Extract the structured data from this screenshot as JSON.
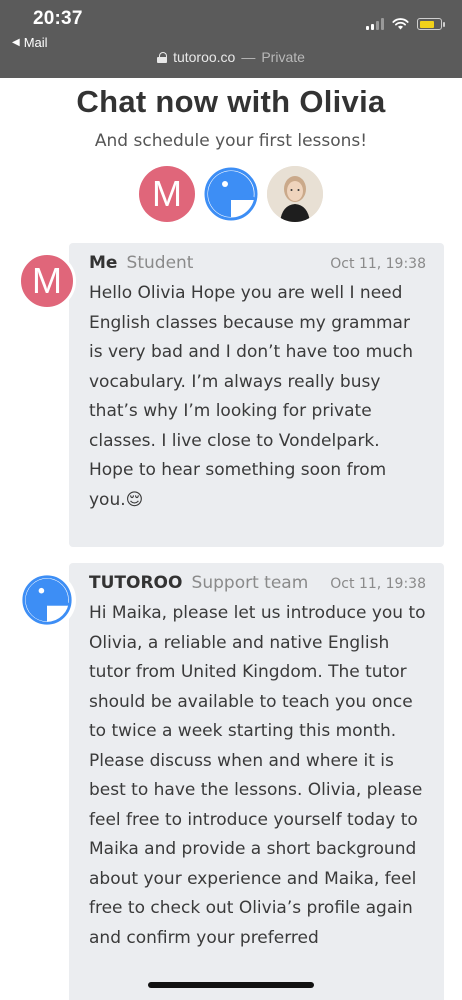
{
  "status_bar": {
    "time": "20:37",
    "back_label": "Mail",
    "url": "tutoroo.co",
    "url_separator": "—",
    "privacy": "Private",
    "battery_color": "#f2d21a",
    "icons": [
      "signal-icon",
      "wifi-icon",
      "battery-icon",
      "lock-icon"
    ]
  },
  "header": {
    "title": "Chat now with Olivia",
    "subtitle": "And schedule your first lessons!",
    "avatars": [
      {
        "type": "letter",
        "letter": "M",
        "color": "#e0667a"
      },
      {
        "type": "logo",
        "name": "tutoroo-logo-icon",
        "color": "#3d8ef5"
      },
      {
        "type": "photo",
        "name": "olivia-photo"
      }
    ]
  },
  "messages": [
    {
      "sender": "Me",
      "role": "Student",
      "timestamp": "Oct 11, 19:38",
      "avatar_letter": "M",
      "text": "Hello Olivia Hope you are well I need English classes because my grammar is very bad and I don’t have too much vocabulary. I’m always really busy that’s why I’m looking for private classes. I live close to Vondelpark. Hope to hear something soon from you.😌"
    },
    {
      "sender": "TUTOROO",
      "role": "Support team",
      "timestamp": "Oct 11, 19:38",
      "avatar_letter": "",
      "text": "Hi Maika, please let us introduce you to Olivia, a reliable and native English tutor from United Kingdom. The tutor should be available to teach you once to twice a week starting this month. Please discuss when and where it is best to have the lessons. Olivia, please feel free to introduce yourself today to Maika and provide a short background about your experience and Maika, feel free to check out Olivia’s profile again and confirm your preferred"
    }
  ],
  "colors": {
    "accent_pink": "#e0667a",
    "brand_blue": "#3d8ef5",
    "bubble_bg": "#ebedf0"
  }
}
